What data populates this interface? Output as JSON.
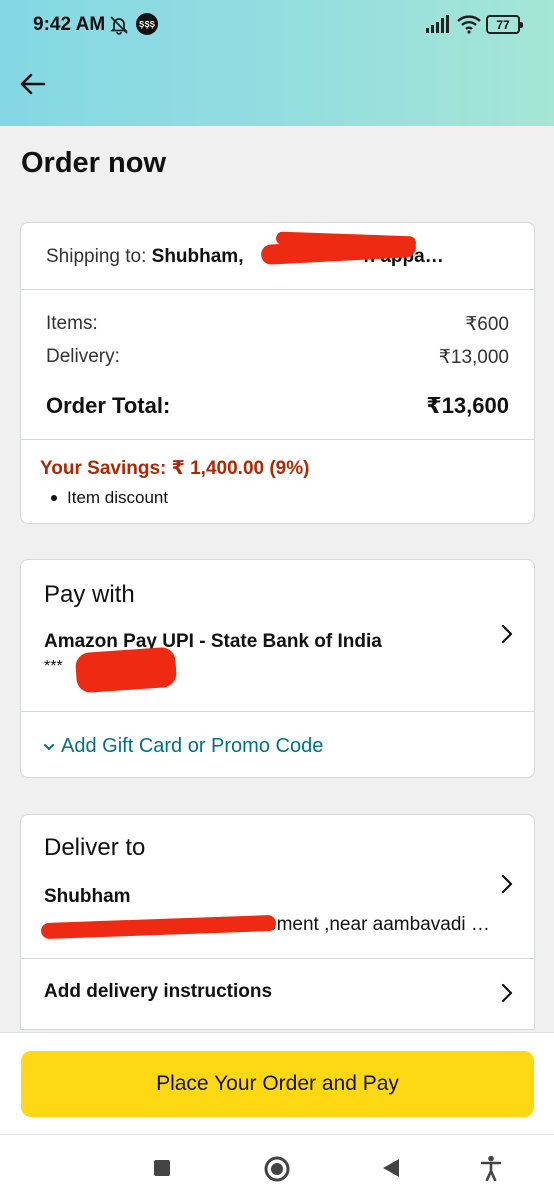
{
  "status_bar": {
    "time": "9:42 AM",
    "notif_badge": "ŞŞŞ",
    "battery": "77"
  },
  "header": {
    "title": "Order now"
  },
  "summary": {
    "shipping_prefix": "Shipping to: ",
    "shipping_name": "Shubham,",
    "shipping_tail": "h appa…",
    "items_label": "Items:",
    "items_value": "₹600",
    "delivery_label": "Delivery:",
    "delivery_value": "₹13,000",
    "total_label": "Order Total:",
    "total_value": "₹13,600",
    "savings": "Your Savings: ₹ 1,400.00 (9%)",
    "savings_detail": "Item discount"
  },
  "payment": {
    "title": "Pay with",
    "method": "Amazon Pay UPI - State Bank of India",
    "masked": "***",
    "gift_link": "Add Gift Card or Promo Code"
  },
  "delivery": {
    "title": "Deliver to",
    "name": "Shubham",
    "address": "ement ,near aambavadi …",
    "instructions": "Add delivery instructions"
  },
  "cta": {
    "label": "Place Your Order and Pay"
  },
  "colors": {
    "accent_link": "#007185",
    "savings": "#b12704",
    "cta": "#ffd814"
  }
}
